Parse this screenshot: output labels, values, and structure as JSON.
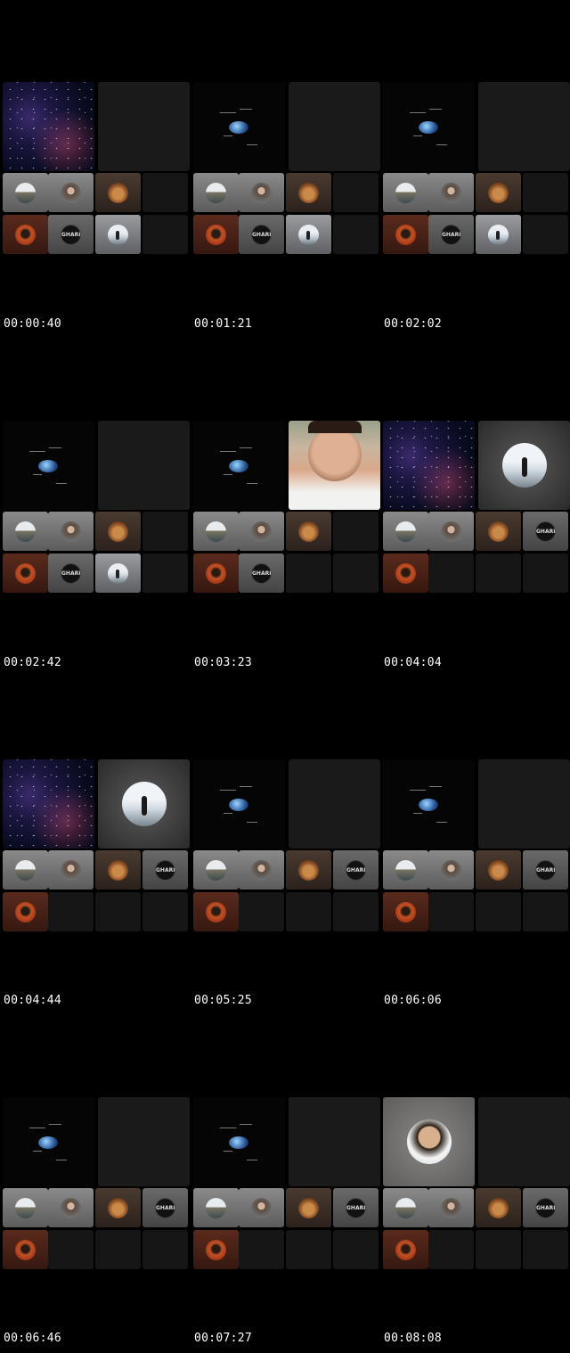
{
  "timestamps": [
    "00:00:40",
    "00:01:21",
    "00:02:02",
    "00:02:42",
    "00:03:23",
    "00:04:04",
    "00:04:44",
    "00:05:25",
    "00:06:06",
    "00:06:46",
    "00:07:27",
    "00:08:08"
  ],
  "avatars": {
    "building": "building-photo-avatar",
    "woman": "woman-portrait-avatar",
    "cat": "cat-avatar",
    "man": "man-red-background-avatar",
    "gharib": "GHARIB",
    "snow": "person-in-snow-avatar"
  }
}
